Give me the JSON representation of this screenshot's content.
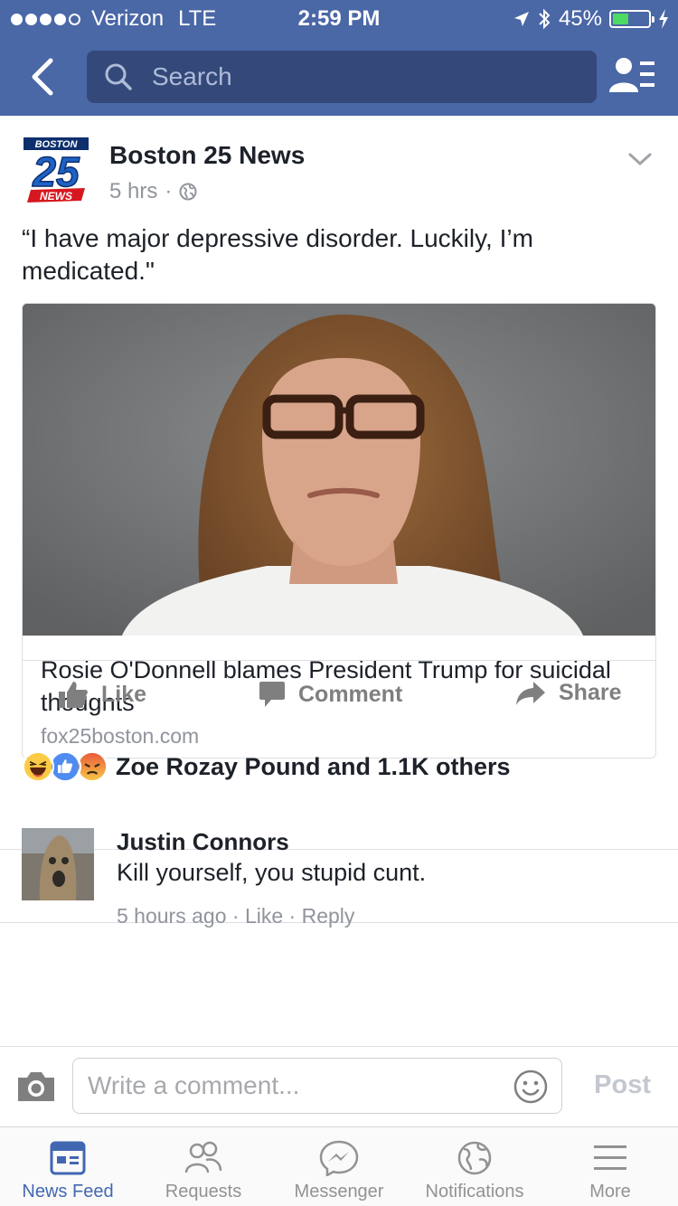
{
  "status_bar": {
    "carrier": "Verizon",
    "network": "LTE",
    "time": "2:59 PM",
    "battery": "45%",
    "battery_level": 0.45
  },
  "nav": {
    "search_placeholder": "Search"
  },
  "post": {
    "page_name": "Boston 25 News",
    "time": "5 hrs",
    "text": "“I have major depressive disorder. Luckily, I’m medicated.\"",
    "logo": {
      "top": "BOSTON",
      "number": "25",
      "bottom": "NEWS"
    },
    "link": {
      "title": "Rosie O'Donnell blames President Trump for suicidal thoughts",
      "domain": "fox25boston.com"
    }
  },
  "actions": {
    "like": "Like",
    "comment": "Comment",
    "share": "Share"
  },
  "reactions": {
    "summary": "Zoe Rozay Pound and 1.1K others",
    "icons": [
      "haha-icon",
      "like-icon",
      "angry-icon"
    ]
  },
  "comment": {
    "author": "Justin Connors",
    "text": "Kill yourself, you stupid cunt.",
    "time": "5 hours ago",
    "like": "Like",
    "reply": "Reply"
  },
  "composer": {
    "placeholder": "Write a comment...",
    "post_label": "Post"
  },
  "tabs": [
    {
      "label": "News Feed",
      "icon": "news-feed-icon",
      "active": true
    },
    {
      "label": "Requests",
      "icon": "friend-requests-icon",
      "active": false
    },
    {
      "label": "Messenger",
      "icon": "messenger-icon",
      "active": false
    },
    {
      "label": "Notifications",
      "icon": "globe-icon",
      "active": false
    },
    {
      "label": "More",
      "icon": "menu-icon",
      "active": false
    }
  ],
  "colors": {
    "header": "#4a67a6",
    "search_bg": "#34497a",
    "active_tab": "#4267b2",
    "muted": "#90949c"
  }
}
